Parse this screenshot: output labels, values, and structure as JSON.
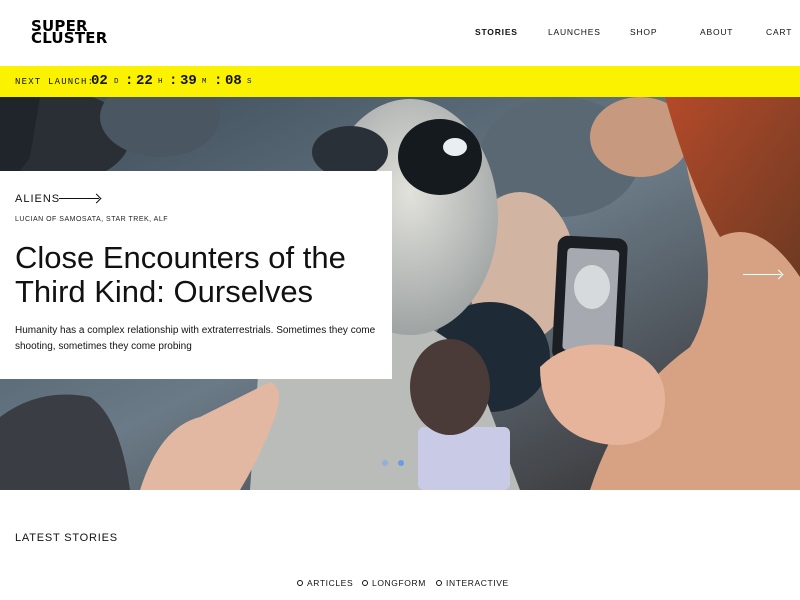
{
  "brand": {
    "line1": "SUPER",
    "line2": "CLUSTER"
  },
  "nav": {
    "items": [
      "STORIES",
      "LAUNCHES",
      "SHOP",
      "ABOUT",
      "CART"
    ],
    "active": "STORIES"
  },
  "countdown": {
    "label": "NEXT LAUNCH:",
    "days": "02",
    "days_unit": "D",
    "hours": "22",
    "hours_unit": "H",
    "minutes": "39",
    "minutes_unit": "M",
    "seconds": "08",
    "seconds_unit": "S",
    "separator": ":"
  },
  "hero": {
    "category": "ALIENS",
    "tags": "LUCIAN OF SAMOSATA, STAR TREK, ALF",
    "title": "Close Encounters of the Third Kind: Ourselves",
    "subtitle": "Humanity has a complex relationship with extraterrestrials. Sometimes they come shooting, sometimes they come probing"
  },
  "latest": {
    "heading": "LATEST STORIES",
    "filters": [
      "ARTICLES",
      "LONGFORM",
      "INTERACTIVE"
    ]
  },
  "colors": {
    "accent_bar": "#fbf200",
    "background": "#ffffff",
    "text": "#111111"
  }
}
